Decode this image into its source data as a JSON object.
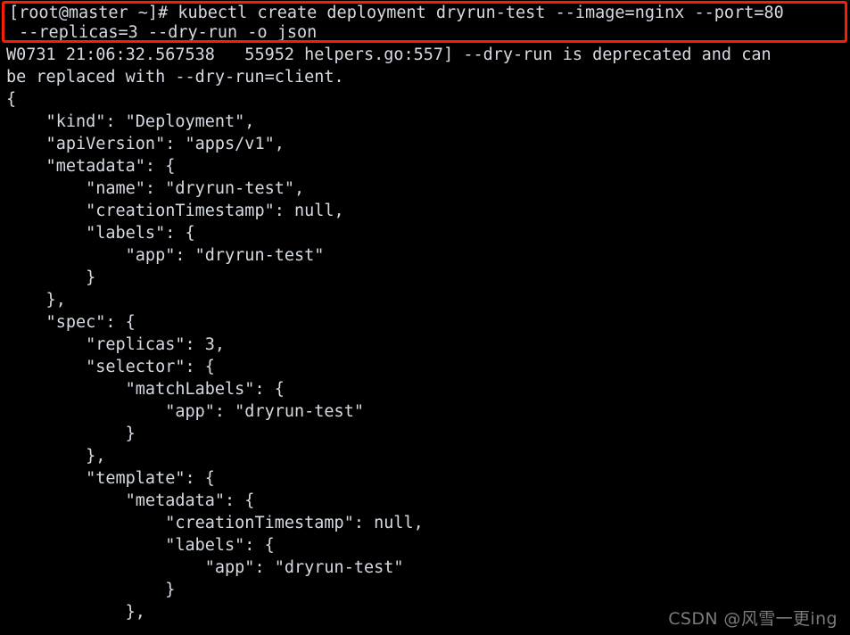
{
  "terminal": {
    "background_color": "#000000",
    "foreground_color": "#d6dbe3",
    "highlight_box_color": "#fb1d05",
    "prompt": "[root@master ~]#",
    "command_block": {
      "lines": [
        "[root@master ~]# kubectl create deployment dryrun-test --image=nginx --port=80",
        " --replicas=3 --dry-run -o json"
      ]
    },
    "output_lines": [
      "W0731 21:06:32.567538   55952 helpers.go:557] --dry-run is deprecated and can",
      "be replaced with --dry-run=client.",
      "{",
      "    \"kind\": \"Deployment\",",
      "    \"apiVersion\": \"apps/v1\",",
      "    \"metadata\": {",
      "        \"name\": \"dryrun-test\",",
      "        \"creationTimestamp\": null,",
      "        \"labels\": {",
      "            \"app\": \"dryrun-test\"",
      "        }",
      "    },",
      "    \"spec\": {",
      "        \"replicas\": 3,",
      "        \"selector\": {",
      "            \"matchLabels\": {",
      "                \"app\": \"dryrun-test\"",
      "            }",
      "        },",
      "        \"template\": {",
      "            \"metadata\": {",
      "                \"creationTimestamp\": null,",
      "                \"labels\": {",
      "                    \"app\": \"dryrun-test\"",
      "                }",
      "            },"
    ]
  },
  "watermark": {
    "text": "CSDN @风雪一更ing"
  }
}
